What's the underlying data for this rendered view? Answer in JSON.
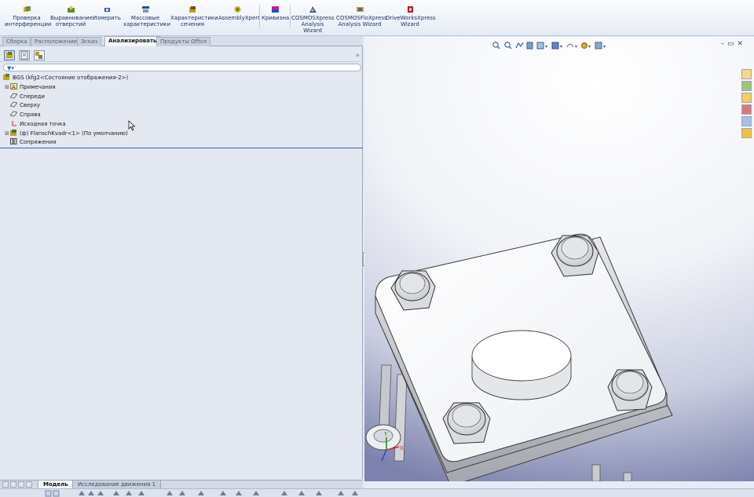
{
  "ribbon": {
    "buttons": [
      {
        "label": "Проверка интерференции",
        "icon": "interference-check-icon"
      },
      {
        "label": "Выравнивание отверстий",
        "icon": "hole-alignment-icon"
      },
      {
        "label": "Измерить",
        "icon": "measure-icon"
      },
      {
        "label": "Массовые характеристики",
        "icon": "mass-properties-icon"
      },
      {
        "label": "Характеристики сечения",
        "icon": "section-properties-icon"
      },
      {
        "label": "AssemblyXpert",
        "icon": "assemblyxpert-icon"
      },
      {
        "label": "Кривизна",
        "icon": "curvature-icon"
      },
      {
        "label": "COSMOSXpress Analysis Wizard",
        "icon": "cosmosxpress-icon"
      },
      {
        "label": "COSMOSFloXpress Analysis Wizard",
        "icon": "cosmosfloxpress-icon"
      },
      {
        "label": "DriveWorksXpress Wizard",
        "icon": "driveworksxpress-icon"
      }
    ]
  },
  "command_tabs": [
    "Сборка",
    "Расположение",
    "Эскиз",
    "Анализировать",
    "Продукты Office"
  ],
  "active_command_tab": "Анализировать",
  "feature_tree": {
    "root": "BGS  (kfg2<Состояние отображения-2>)",
    "items": [
      {
        "label": "Примечания",
        "expandable": true,
        "icon": "annotations-icon"
      },
      {
        "label": "Спереди",
        "expandable": false,
        "icon": "plane-icon"
      },
      {
        "label": "Сверху",
        "expandable": false,
        "icon": "plane-icon"
      },
      {
        "label": "Справа",
        "expandable": false,
        "icon": "plane-icon"
      },
      {
        "label": "Исходная точка",
        "expandable": false,
        "icon": "origin-icon"
      },
      {
        "label": "(ф) FlanschKvadr<1> (По умолчанию)",
        "expandable": true,
        "icon": "part-icon"
      },
      {
        "label": "Сопряжения",
        "expandable": false,
        "icon": "mates-icon"
      }
    ]
  },
  "bottom_tabs": [
    "Модель",
    "Исследование движения 1"
  ],
  "active_bottom_tab": "Модель",
  "viewport": {
    "triad_axes": [
      "X",
      "Y"
    ]
  }
}
